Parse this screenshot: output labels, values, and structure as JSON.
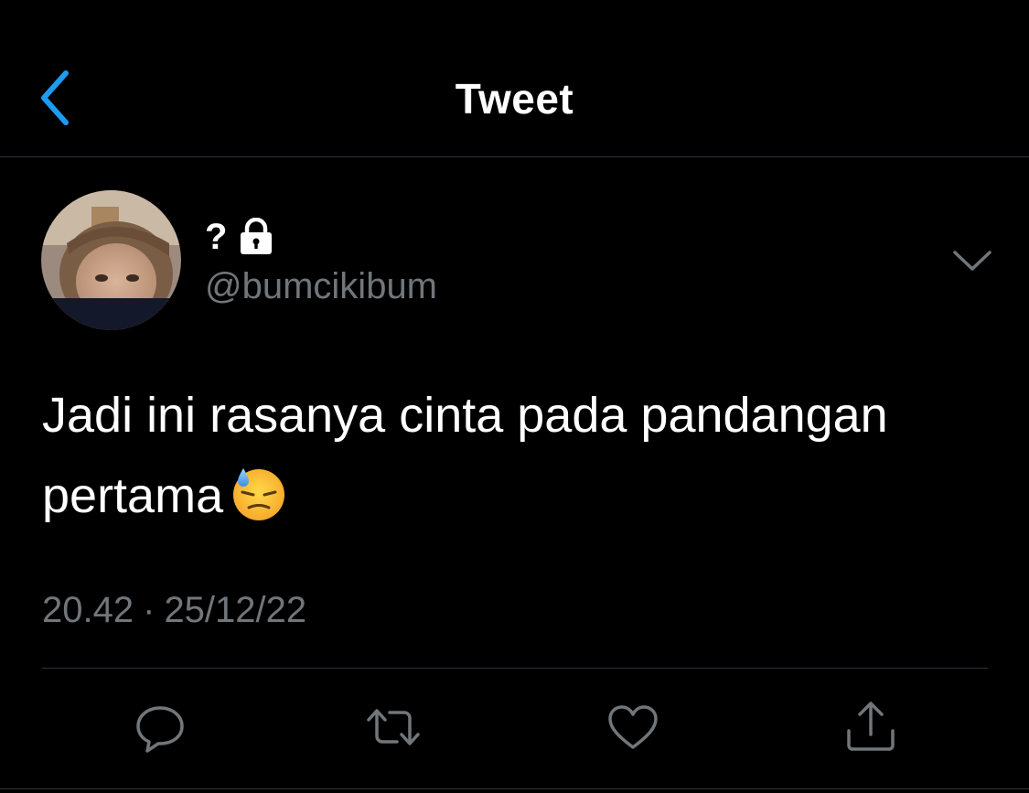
{
  "header": {
    "title": "Tweet",
    "back_icon": "chevron-left-icon"
  },
  "author": {
    "display_name": "?",
    "handle": "@bumcikibum",
    "protected_icon": "lock-icon"
  },
  "tweet": {
    "text_line1": "Jadi ini rasanya cinta pada pandangan",
    "text_line2": "pertama",
    "emoji": "downcast-face-with-sweat-emoji",
    "time": "20.42",
    "separator": "·",
    "date": "25/12/22"
  },
  "actions": [
    {
      "name": "reply",
      "icon": "reply-icon"
    },
    {
      "name": "retweet",
      "icon": "retweet-icon"
    },
    {
      "name": "like",
      "icon": "heart-icon"
    },
    {
      "name": "share",
      "icon": "share-icon"
    }
  ],
  "colors": {
    "background": "#000000",
    "accent": "#1d9bf0",
    "secondary_text": "#71767b",
    "divider": "#2f3336"
  }
}
